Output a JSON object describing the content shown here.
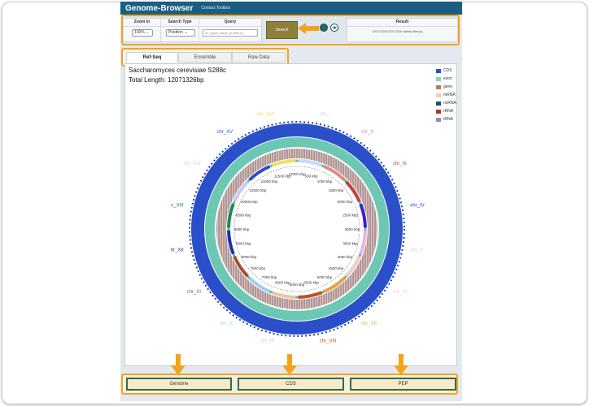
{
  "app": {
    "title": "Genome-Browser",
    "subtitle": "Contact Toolbox"
  },
  "controls": {
    "zoom_header": "Zoom In",
    "zoom_value": "100% ⌄",
    "search_type_header": "Search Type",
    "search_type_value": "Position ⌄",
    "query_header": "Query",
    "query_placeholder": "ex.) gene name, protein id..",
    "search_label": "Search",
    "result_header": "Result",
    "result_text": "12071326/12071326 satisfy filter(s)"
  },
  "tabs": [
    "Ref-Seq",
    "Ensemble",
    "Raw Data"
  ],
  "active_tab": 0,
  "organism": "Saccharomyces cerevisiae S288c",
  "total_length": "Total Length: 12071326bp",
  "legend": [
    {
      "label": "CDS",
      "color": "#2a4fc9"
    },
    {
      "label": "exon",
      "color": "#7fd6c6"
    },
    {
      "label": "gene",
      "color": "#b8805a"
    },
    {
      "label": "mRNA",
      "color": "#f5c9b6"
    },
    {
      "label": "ncRNA",
      "color": "#1f4f7a"
    },
    {
      "label": "rRNA",
      "color": "#c0312f"
    },
    {
      "label": "tRNA",
      "color": "#9a87c8"
    }
  ],
  "chromosomes": [
    {
      "label": "chr_I",
      "color": "#c9d8f5"
    },
    {
      "label": "chr_II",
      "color": "#e08a8a"
    },
    {
      "label": "chr_III",
      "color": "#c44040"
    },
    {
      "label": "chr_IV",
      "color": "#3b1fd6"
    },
    {
      "label": "chr_V",
      "color": "#e7b3e7"
    },
    {
      "label": "chr_VI",
      "color": "#f2c9c9"
    },
    {
      "label": "chr_VII",
      "color": "#e6a23c"
    },
    {
      "label": "chr_VIII",
      "color": "#c05020"
    },
    {
      "label": "chr_IX",
      "color": "#f1c2a8"
    },
    {
      "label": "chr_X",
      "color": "#9cd0f0"
    },
    {
      "label": "chr_XI",
      "color": "#a0522d"
    },
    {
      "label": "chr_XII",
      "color": "#1f2fa8"
    },
    {
      "label": "chr_XIII",
      "color": "#1f8a4a"
    },
    {
      "label": "chr_XIV",
      "color": "#c9c9f0"
    },
    {
      "label": "chr_XV",
      "color": "#2a4fc9"
    },
    {
      "label": "chr_XVI",
      "color": "#f0e060"
    }
  ],
  "kbp_labels": [
    "12000 kbp",
    "500 kbp",
    "1000 kbp",
    "1500 kbp",
    "2000 kbp",
    "2500 kbp",
    "3000 kbp",
    "3500 kbp",
    "4000 kbp",
    "4500 kbp",
    "5000 kbp",
    "5500 kbp",
    "6000 kbp",
    "6500 kbp",
    "7000 kbp",
    "7500 kbp",
    "8000 kbp",
    "8500 kbp",
    "9000 kbp",
    "9500 kbp",
    "10000 kbp",
    "10500 kbp",
    "11000 kbp",
    "11500 kbp"
  ],
  "downloads": [
    "Genome",
    "CDS",
    "PEP"
  ],
  "colors": {
    "header": "#1b5e83",
    "highlight": "#f4a31c",
    "outer_ring": "#2a4fc9",
    "inner_ring": "#5bbfa6"
  }
}
